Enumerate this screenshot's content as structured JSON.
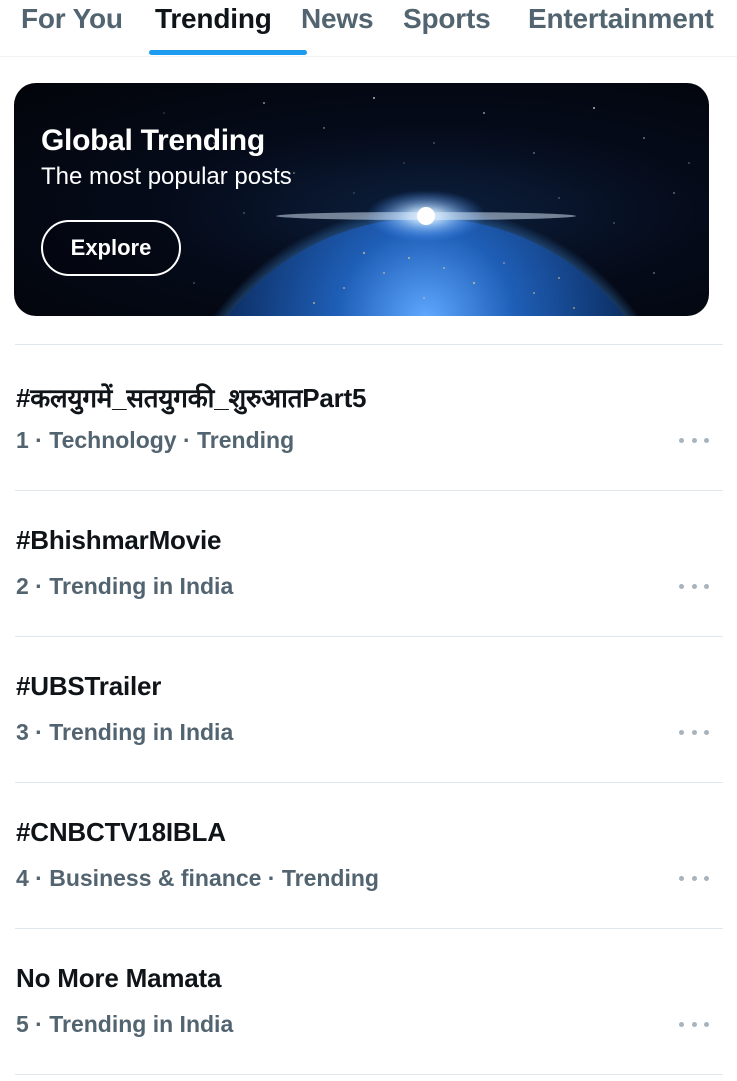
{
  "tabs": [
    {
      "label": "For You"
    },
    {
      "label": "Trending"
    },
    {
      "label": "News"
    },
    {
      "label": "Sports"
    },
    {
      "label": "Entertainment"
    }
  ],
  "active_tab": "Trending",
  "banner": {
    "title": "Global Trending",
    "subtitle": "The most popular posts",
    "button_label": "Explore"
  },
  "trends": [
    {
      "title": "#कलयुगमें_सतयुगकी_शुरुआतPart5",
      "meta": "1 · Technology · Trending"
    },
    {
      "title": "#BhishmarMovie",
      "meta": "2 · Trending in India"
    },
    {
      "title": "#UBSTrailer",
      "meta": "3 · Trending in India"
    },
    {
      "title": "#CNBCTV18IBLA",
      "meta": "4 · Business & finance · Trending"
    },
    {
      "title": "No More Mamata",
      "meta": "5 · Trending in India"
    }
  ],
  "colors": {
    "accent": "#1d9bf0",
    "text_primary": "#0f1419",
    "text_secondary": "#536471"
  },
  "icons": {
    "more": "more-horizontal-icon",
    "banner_image": "earth-globe-icon"
  }
}
